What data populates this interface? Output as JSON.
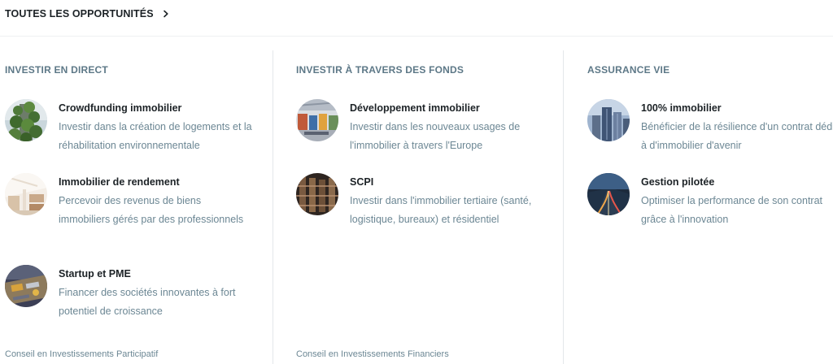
{
  "top_link": {
    "label": "TOUTES LES OPPORTUNITÉS"
  },
  "columns": [
    {
      "title": "INVESTIR EN DIRECT",
      "items": [
        {
          "name": "Crowdfunding immobilier",
          "description": "Investir dans la création de logements et la réhabilitation environnementale",
          "thumb": "green-tower"
        },
        {
          "name": "Immobilier de rendement",
          "description": "Percevoir des revenus de biens immobiliers gérés par des professionnels",
          "thumb": "bright-interior"
        },
        {
          "name": "Startup et PME",
          "description": "Financer des sociétés innovantes à fort potentiel de croissance",
          "thumb": "workbench"
        }
      ],
      "footer": "Conseil en Investissements Participatif"
    },
    {
      "title": "INVESTIR À TRAVERS DES FONDS",
      "items": [
        {
          "name": "Développement immobilier",
          "description": "Investir dans les nouveaux usages de l'immobilier à travers l'Europe",
          "thumb": "office-space"
        },
        {
          "name": "SCPI",
          "description": "Investir dans l'immobilier tertiaire (santé, logistique, bureaux) et résidentiel",
          "thumb": "warehouse"
        }
      ],
      "footer": "Conseil en Investissements Financiers"
    },
    {
      "title": "ASSURANCE VIE",
      "items": [
        {
          "name": "100% immobilier",
          "description": "Bénéficier de la résilience d'un contrat dédié à d'immobilier d'avenir",
          "thumb": "skyscrapers"
        },
        {
          "name": "Gestion pilotée",
          "description": "Optimiser la performance de son contrat grâce à l'innovation",
          "thumb": "road-night"
        }
      ],
      "footer": ""
    }
  ]
}
